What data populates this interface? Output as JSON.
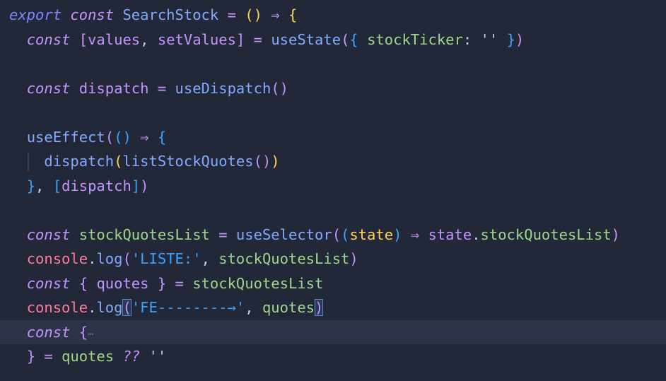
{
  "editor": {
    "language": "javascript",
    "theme": {
      "background": "#222837",
      "current_line": "#2d3448"
    },
    "current_line_index": 13,
    "lines": [
      [
        [
          "export",
          "#7f86ff",
          "italic"
        ],
        [
          " ",
          "#c7cde0"
        ],
        [
          "const",
          "#c594ff",
          "italic"
        ],
        [
          " ",
          "#c7cde0"
        ],
        [
          "SearchStock",
          "#82aaff"
        ],
        [
          " ",
          "#c7cde0"
        ],
        [
          "=",
          "#c594ff"
        ],
        [
          " ",
          "#c7cde0"
        ],
        [
          "()",
          "#ffd44f"
        ],
        [
          " ",
          "#c7cde0"
        ],
        [
          "⇒",
          "#c594ff"
        ],
        [
          " ",
          "#c7cde0"
        ],
        [
          "{",
          "#ffd44f"
        ]
      ],
      [
        [
          "  ",
          "#c7cde0"
        ],
        [
          "const",
          "#c594ff",
          "italic"
        ],
        [
          " ",
          "#c7cde0"
        ],
        [
          "[",
          "#c594ff"
        ],
        [
          "values",
          "#c594ff"
        ],
        [
          ", ",
          "#c7cde0"
        ],
        [
          "setValues",
          "#c594ff"
        ],
        [
          "]",
          "#c594ff"
        ],
        [
          " ",
          "#c7cde0"
        ],
        [
          "=",
          "#c594ff"
        ],
        [
          " ",
          "#c7cde0"
        ],
        [
          "useState",
          "#82aaff"
        ],
        [
          "(",
          "#c594ff"
        ],
        [
          "{",
          "#38a4ff"
        ],
        [
          " ",
          "#c7cde0"
        ],
        [
          "stockTicker",
          "#9ed78c"
        ],
        [
          ": ",
          "#c7cde0"
        ],
        [
          "''",
          "#c7cde0"
        ],
        [
          " ",
          "#c7cde0"
        ],
        [
          "}",
          "#38a4ff"
        ],
        [
          ")",
          "#c594ff"
        ]
      ],
      [],
      [
        [
          "  ",
          "#c7cde0"
        ],
        [
          "const",
          "#c594ff",
          "italic"
        ],
        [
          " ",
          "#c7cde0"
        ],
        [
          "dispatch",
          "#c594ff"
        ],
        [
          " ",
          "#c7cde0"
        ],
        [
          "=",
          "#c594ff"
        ],
        [
          " ",
          "#c7cde0"
        ],
        [
          "useDispatch",
          "#82aaff"
        ],
        [
          "()",
          "#c594ff"
        ]
      ],
      [],
      [
        [
          "  ",
          "#c7cde0"
        ],
        [
          "useEffect",
          "#82aaff"
        ],
        [
          "(",
          "#c594ff"
        ],
        [
          "()",
          "#38a4ff"
        ],
        [
          " ",
          "#c7cde0"
        ],
        [
          "⇒",
          "#c594ff"
        ],
        [
          " ",
          "#c7cde0"
        ],
        [
          "{",
          "#38a4ff"
        ]
      ],
      [
        [
          "    ",
          "#c7cde0"
        ],
        [
          "dispatch",
          "#82aaff"
        ],
        [
          "(",
          "#ffd44f"
        ],
        [
          "listStockQuotes",
          "#82aaff"
        ],
        [
          "(",
          "#c594ff"
        ],
        [
          ")",
          "#c594ff"
        ],
        [
          ")",
          "#ffd44f"
        ]
      ],
      [
        [
          "  ",
          "#c7cde0"
        ],
        [
          "}",
          "#38a4ff"
        ],
        [
          ", ",
          "#c7cde0"
        ],
        [
          "[",
          "#38a4ff"
        ],
        [
          "dispatch",
          "#c594ff"
        ],
        [
          "]",
          "#38a4ff"
        ],
        [
          ")",
          "#c594ff"
        ]
      ],
      [],
      [
        [
          "  ",
          "#c7cde0"
        ],
        [
          "const",
          "#c594ff",
          "italic"
        ],
        [
          " ",
          "#c7cde0"
        ],
        [
          "stockQuotesList",
          "#9ed78c"
        ],
        [
          " ",
          "#c7cde0"
        ],
        [
          "=",
          "#c594ff"
        ],
        [
          " ",
          "#c7cde0"
        ],
        [
          "useSelector",
          "#82aaff"
        ],
        [
          "(",
          "#c594ff"
        ],
        [
          "(",
          "#38a4ff"
        ],
        [
          "state",
          "#ffd44f"
        ],
        [
          ")",
          "#38a4ff"
        ],
        [
          " ",
          "#c7cde0"
        ],
        [
          "⇒",
          "#c594ff"
        ],
        [
          " ",
          "#c7cde0"
        ],
        [
          "state",
          "#c594ff"
        ],
        [
          ".",
          "#c7cde0"
        ],
        [
          "stockQuotesList",
          "#9ed78c"
        ],
        [
          ")",
          "#c594ff"
        ]
      ],
      [
        [
          "  ",
          "#c7cde0"
        ],
        [
          "console",
          "#ff7b9c"
        ],
        [
          ".",
          "#c7cde0"
        ],
        [
          "log",
          "#82aaff"
        ],
        [
          "(",
          "#c594ff"
        ],
        [
          "'LISTE:'",
          "#38a4ff"
        ],
        [
          ", ",
          "#c7cde0"
        ],
        [
          "stockQuotesList",
          "#9ed78c"
        ],
        [
          ")",
          "#c594ff"
        ]
      ],
      [
        [
          "  ",
          "#c7cde0"
        ],
        [
          "const",
          "#c594ff",
          "italic"
        ],
        [
          " ",
          "#c7cde0"
        ],
        [
          "{",
          "#c594ff"
        ],
        [
          " ",
          "#c7cde0"
        ],
        [
          "quotes",
          "#c594ff"
        ],
        [
          " ",
          "#c7cde0"
        ],
        [
          "}",
          "#c594ff"
        ],
        [
          " ",
          "#c7cde0"
        ],
        [
          "=",
          "#c594ff"
        ],
        [
          " ",
          "#c7cde0"
        ],
        [
          "stockQuotesList",
          "#9ed78c"
        ]
      ],
      [
        [
          "  ",
          "#c7cde0"
        ],
        [
          "console",
          "#ff7b9c"
        ],
        [
          ".",
          "#c7cde0"
        ],
        [
          "log",
          "#82aaff"
        ],
        [
          "(",
          "#c594ff",
          "box"
        ],
        [
          "'FE--------→'",
          "#38a4ff"
        ],
        [
          ", ",
          "#c7cde0"
        ],
        [
          "quotes",
          "#9ed78c"
        ],
        [
          ")",
          "#c594ff",
          "box"
        ]
      ],
      [
        [
          "  ",
          "#c7cde0"
        ],
        [
          "const",
          "#c594ff",
          "italic"
        ],
        [
          " ",
          "#c7cde0"
        ],
        [
          "{",
          "#c594ff"
        ],
        [
          "⋯",
          "#6f7790",
          "fold"
        ]
      ],
      [
        [
          "  ",
          "#c7cde0"
        ],
        [
          "}",
          "#c594ff"
        ],
        [
          " ",
          "#c7cde0"
        ],
        [
          "=",
          "#c594ff"
        ],
        [
          " ",
          "#c7cde0"
        ],
        [
          "quotes",
          "#9ed78c"
        ],
        [
          " ",
          "#c7cde0"
        ],
        [
          "??",
          "#c594ff",
          "italic"
        ],
        [
          " ",
          "#c7cde0"
        ],
        [
          "''",
          "#c7cde0"
        ]
      ]
    ]
  }
}
